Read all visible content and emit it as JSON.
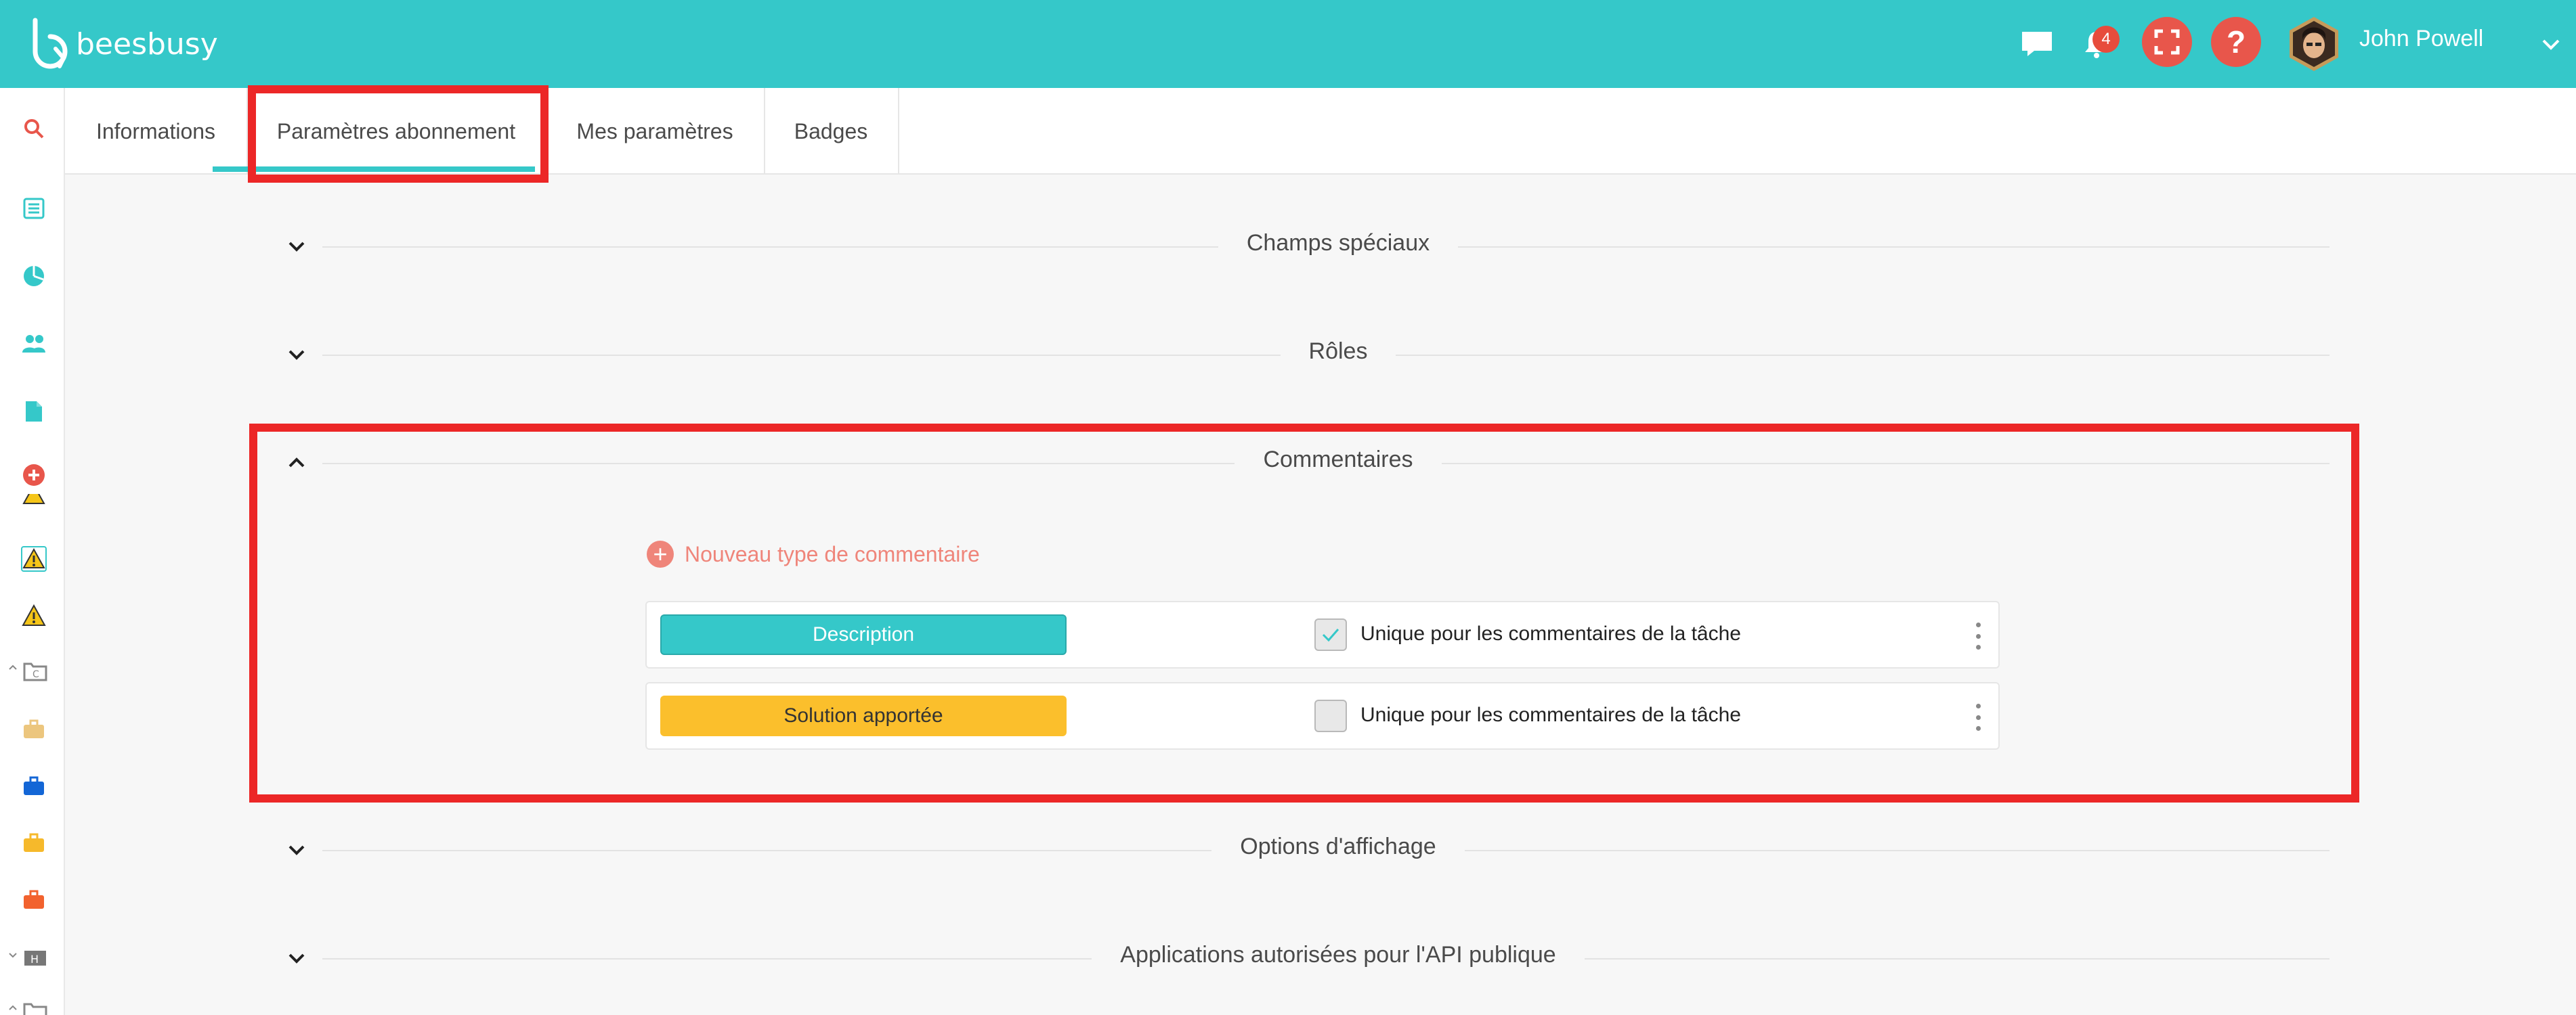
{
  "app": {
    "name": "beesbusy"
  },
  "header": {
    "notification_count": "4",
    "user_name": "John Powell",
    "icons": [
      "chat-icon",
      "bell-icon",
      "fullscreen-icon",
      "help-icon",
      "user-avatar",
      "chevron-down-icon"
    ]
  },
  "sidebar": {
    "icons": [
      "search-icon",
      "list-icon",
      "pie-chart-icon",
      "users-icon",
      "document-icon",
      "add-circle-icon",
      "warning-icon",
      "warning-icon",
      "warning-icon",
      "folder-icon",
      "briefcase-icon",
      "briefcase-icon",
      "briefcase-icon",
      "briefcase-icon",
      "folder-icon",
      "folder-icon"
    ]
  },
  "tabs": [
    {
      "label": "Informations"
    },
    {
      "label": "Paramètres abonnement",
      "active": true
    },
    {
      "label": "Mes paramètres"
    },
    {
      "label": "Badges"
    }
  ],
  "sections": [
    {
      "title": "Champs spéciaux",
      "expanded": false
    },
    {
      "title": "Rôles",
      "expanded": false
    },
    {
      "title": "Commentaires",
      "expanded": true
    },
    {
      "title": "Options d'affichage",
      "expanded": false
    },
    {
      "title": "Applications autorisées pour l'API publique",
      "expanded": false
    }
  ],
  "comments": {
    "new_label": "Nouveau type de commentaire",
    "types": [
      {
        "label": "Description",
        "color": "#35c8c9",
        "text_color": "#ffffff",
        "unique": true,
        "unique_label": "Unique pour les commentaires de la tâche"
      },
      {
        "label": "Solution apportée",
        "color": "#fbbf2c",
        "text_color": "#333333",
        "unique": false,
        "unique_label": "Unique pour les commentaires de la tâche"
      }
    ]
  },
  "colors": {
    "brand": "#35c8c9",
    "accent_red": "#e8564b",
    "highlight": "#ec2727"
  }
}
